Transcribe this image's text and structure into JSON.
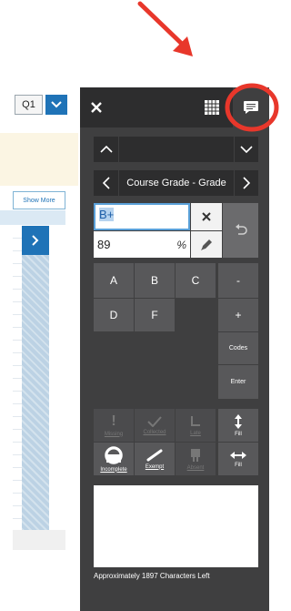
{
  "background": {
    "quarter_select": "Q1",
    "show_more_label": "Show More"
  },
  "panel": {
    "topbar": {
      "close_icon": "close-icon",
      "grid_icon": "grid-icon",
      "comment_icon": "comment-icon"
    },
    "course_nav": {
      "title": "Course Grade - Grade"
    },
    "grade_input": {
      "value": "B+"
    },
    "percent_input": {
      "value": "89",
      "unit": "%"
    },
    "keypad": {
      "a": "A",
      "b": "B",
      "c": "C",
      "minus": "-",
      "d": "D",
      "f": "F",
      "plus": "+",
      "codes": "Codes",
      "enter": "Enter"
    },
    "flags": {
      "missing": "Missing",
      "collected": "Collected",
      "late": "Late",
      "fill_vertical": "Fill",
      "incomplete": "Incomplete",
      "exempt": "Exempt",
      "absent": "Absent",
      "fill_horizontal": "Fill"
    },
    "comment": {
      "chars_left": "Approximately 1897 Characters Left"
    }
  },
  "annotation": {
    "arrow_color": "#e8372b",
    "circle_color": "#e8372b"
  }
}
